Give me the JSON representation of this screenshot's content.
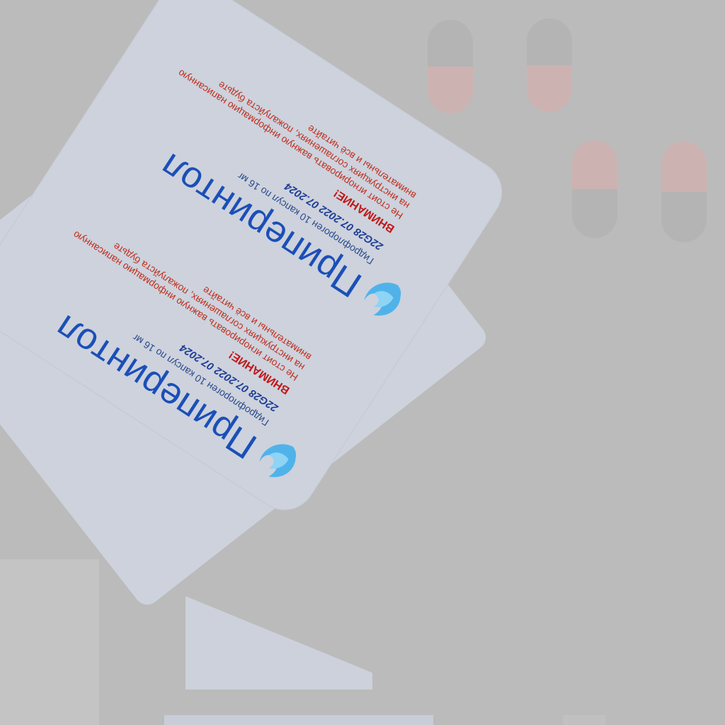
{
  "package": {
    "panels": [
      {
        "title": "Приперинтол",
        "subtitle": "Гидрофлороген 10 капсул по 16 мг",
        "lot": "22G28 07.2022 07.2024",
        "warning_title": "ВНИМАНИЕ!",
        "warning_text": "Не стоит игнорировать важную информацию написанную на инструкциях соглашениях, пожалуйста будьте внимательны и всё читайте"
      },
      {
        "title": "Приперинтол",
        "subtitle": "Гидрофлороген 10 капсул по 16 мг",
        "lot": "22G28 07.2022 07.2024",
        "warning_title": "ВНИМАНИЕ!",
        "warning_text": "Не стоит игнорировать важную информацию написанную на инструкциях соглашениях, пожалуйста будьте внимательны и всё читайте"
      }
    ],
    "logo_icon": "blue-bird-icon"
  },
  "colors": {
    "title": "#1b4fb8",
    "warning": "#c01818",
    "card": "#cdd2dd",
    "capsule_pink": "#cdb2b2",
    "background": "#bbbbbb"
  }
}
